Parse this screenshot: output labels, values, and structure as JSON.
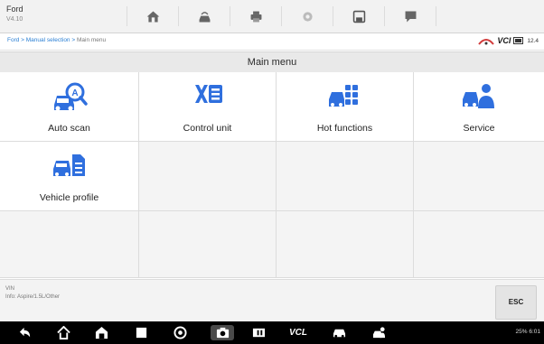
{
  "app": {
    "title": "Ford",
    "version": "V4.10"
  },
  "breadcrumb": {
    "trail": "Ford > Manual selection > ",
    "current": "Main menu"
  },
  "vci": {
    "label": "VCI",
    "battery": "12.4"
  },
  "menu": {
    "title": "Main menu",
    "items": [
      {
        "label": "Auto scan",
        "icon": "auto-scan-icon"
      },
      {
        "label": "Control unit",
        "icon": "control-unit-icon"
      },
      {
        "label": "Hot functions",
        "icon": "hot-functions-icon"
      },
      {
        "label": "Service",
        "icon": "service-icon"
      },
      {
        "label": "Vehicle profile",
        "icon": "vehicle-profile-icon"
      }
    ]
  },
  "footer": {
    "vin_label": "VIN",
    "info": "Info: Aspire/1.5L/Other",
    "esc_label": "ESC"
  },
  "navbar": {
    "vcl_label": "VCL",
    "status": "25% 6:01"
  },
  "colors": {
    "accent_blue": "#2f6fde",
    "nav_bg": "#000000",
    "toolbar_bg": "#f2f2f2"
  }
}
